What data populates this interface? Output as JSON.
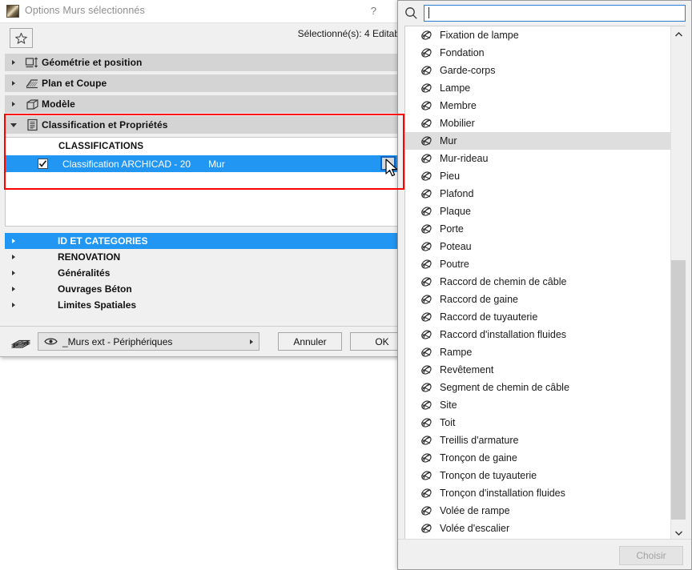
{
  "dialog": {
    "title": "Options Murs sélectionnés",
    "help_label": "?",
    "favorite_icon": "star-icon",
    "selection_status": "Sélectionné(s): 4 Editab",
    "sections": [
      {
        "label": "Géométrie et position",
        "icon": "geometry-icon",
        "expanded": false
      },
      {
        "label": "Plan et Coupe",
        "icon": "plan-section-icon",
        "expanded": false
      },
      {
        "label": "Modèle",
        "icon": "model-icon",
        "expanded": false
      },
      {
        "label": "Classification et Propriétés",
        "icon": "classification-icon",
        "expanded": true
      }
    ],
    "classification": {
      "header": "CLASSIFICATIONS",
      "row": {
        "checked": true,
        "system": "Classification ARCHICAD - 20",
        "value": "Mur"
      }
    },
    "lower_sections": [
      {
        "label": "ID ET CATEGORIES",
        "highlighted": true
      },
      {
        "label": "RENOVATION",
        "highlighted": false
      },
      {
        "label": "Généralités",
        "highlighted": false
      },
      {
        "label": "Ouvrages Béton",
        "highlighted": false
      },
      {
        "label": "Limites Spatiales",
        "highlighted": false
      }
    ],
    "footer": {
      "layer_icon": "layers-icon",
      "eye_icon": "eye-icon",
      "layer_value": "_Murs ext - Périphériques",
      "cancel_label": "Annuler",
      "ok_label": "OK"
    }
  },
  "popup": {
    "search": {
      "icon": "search-icon",
      "value": "",
      "placeholder": ""
    },
    "selected_item": "Mur",
    "items": [
      "Fixation de lampe",
      "Fondation",
      "Garde-corps",
      "Lampe",
      "Membre",
      "Mobilier",
      "Mur",
      "Mur-rideau",
      "Pieu",
      "Plafond",
      "Plaque",
      "Porte",
      "Poteau",
      "Poutre",
      "Raccord de chemin de câble",
      "Raccord de gaine",
      "Raccord de tuyauterie",
      "Raccord d'installation fluides",
      "Rampe",
      "Revêtement",
      "Segment de chemin de câble",
      "Site",
      "Toit",
      "Treillis d'armature",
      "Tronçon de gaine",
      "Tronçon de tuyauterie",
      "Tronçon d'installation fluides",
      "Volée de rampe",
      "Volée d'escalier"
    ],
    "item_icon": "classification-globe-icon",
    "scrollbar": {
      "up_icon": "chevron-up-icon",
      "down_icon": "chevron-down-icon"
    },
    "choose_label": "Choisir",
    "choose_enabled": false
  },
  "colors": {
    "accent_blue": "#2196f3",
    "highlight_red": "#ff0000",
    "selected_gray": "#dedede",
    "section_gray": "#d4d4d4"
  }
}
